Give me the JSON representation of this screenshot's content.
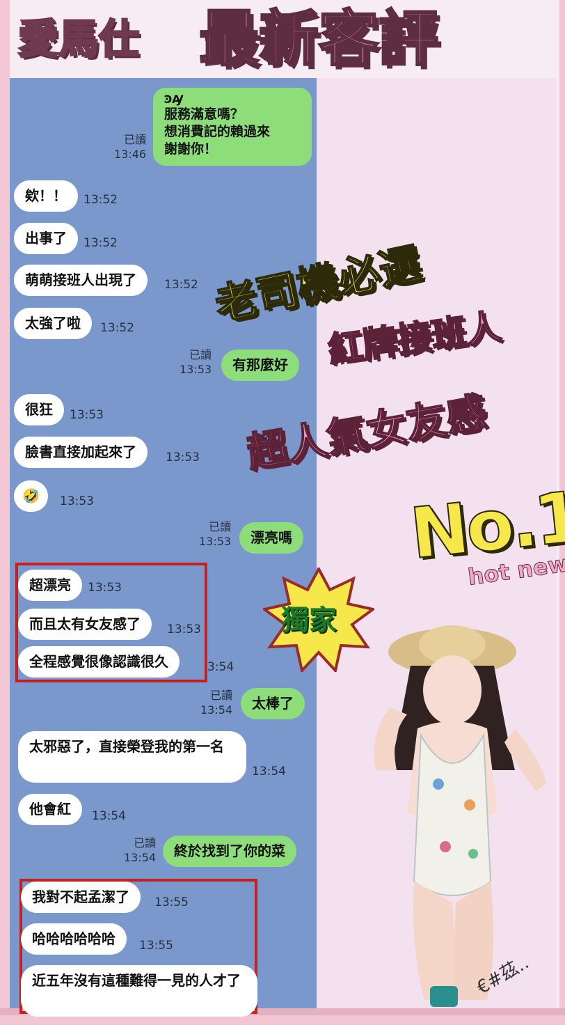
{
  "header": {
    "brand": "愛馬仕",
    "title": "最新客評"
  },
  "chat": {
    "first_message": {
      "sticker": "ꜾꜼ",
      "lines": [
        "服務滿意嗎？",
        "想消費記的賴過來",
        "謝謝你！"
      ],
      "read": "已讀",
      "time": "13:46"
    },
    "messages": [
      {
        "text": "欸！！",
        "time": "13:52"
      },
      {
        "text": "出事了",
        "time": "13:52"
      },
      {
        "text": "萌萌接班人出現了",
        "time": "13:52"
      },
      {
        "text": "太強了啦",
        "time": "13:52"
      },
      {
        "text": "有那麼好",
        "read": "已讀",
        "time": "13:53"
      },
      {
        "text": "很狂",
        "time": "13:53"
      },
      {
        "text": "臉書直接加起來了",
        "time": "13:53"
      },
      {
        "text": "🤣",
        "time": "13:53"
      },
      {
        "text": "漂亮嗎",
        "read": "已讀",
        "time": "13:53"
      },
      {
        "text": "超漂亮",
        "time": "13:53"
      },
      {
        "text": "而且太有女友感了",
        "time": "13:53"
      },
      {
        "text": "全程感覺很像認識很久",
        "time": "3:54"
      },
      {
        "text": "太棒了",
        "read": "已讀",
        "time": "13:54"
      },
      {
        "text": "太邪惡了，直接榮登我的第一名",
        "time": "13:54"
      },
      {
        "text": "他會紅",
        "time": "13:54"
      },
      {
        "text": "終於找到了你的菜",
        "read": "已讀",
        "time": "13:54"
      },
      {
        "text": "我對不起孟潔了",
        "time": "13:55"
      },
      {
        "text": "哈哈哈哈哈哈",
        "time": "13:55"
      },
      {
        "text": "近五年沒有這種難得一見的人才了",
        "time": ""
      }
    ]
  },
  "promo": {
    "line1": "老司機必選",
    "line2": "紅牌接班人",
    "line3": "超人氣女友感",
    "no1": "No.1",
    "hotnew": "hot new",
    "exclusive": "獨家"
  },
  "watermark": "€#茲.."
}
